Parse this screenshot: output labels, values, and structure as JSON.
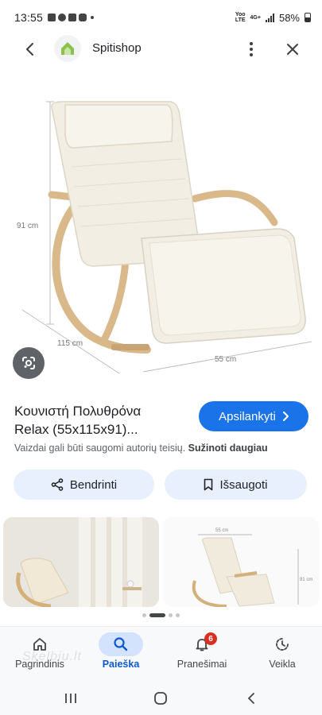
{
  "status_bar": {
    "time": "13:55",
    "network_top": "Yoo",
    "network_bottom": "LTE",
    "net_type": "4G+",
    "battery": "58%"
  },
  "header": {
    "site_name": "Spitishop"
  },
  "product": {
    "dim_height": "91 cm",
    "dim_length": "115 cm",
    "dim_width": "55 cm",
    "title_line1": "Κουνιστή Πολυθρόνα",
    "title_line2": "Relax (55x115x91)...",
    "visit_label": "Apsilankyti",
    "copyright_text": "Vaizdai gali būti saugomi autorių teisių.",
    "learn_more": "Sužinoti daugiau"
  },
  "actions": {
    "share_label": "Bendrinti",
    "save_label": "Išsaugoti"
  },
  "related": {
    "thumb2_dim_top": "55 cm",
    "thumb2_dim_side": "91 cm"
  },
  "bottom_nav": {
    "items": [
      {
        "label": "Pagrindinis",
        "icon": "home-icon"
      },
      {
        "label": "Paieška",
        "icon": "search-icon"
      },
      {
        "label": "Pranešimai",
        "icon": "bell-icon",
        "badge": "6"
      },
      {
        "label": "Veikla",
        "icon": "activity-icon"
      }
    ],
    "active_index": 1
  },
  "watermark": "Skelbiu.lt",
  "colors": {
    "accent": "#1a73e8",
    "chip_bg": "#e8f0fe",
    "nav_active_bg": "#d3e3fd",
    "badge": "#d93025"
  }
}
